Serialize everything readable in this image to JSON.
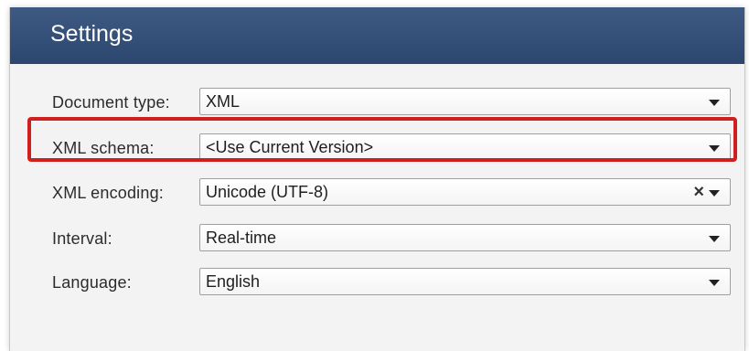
{
  "panel": {
    "title": "Settings"
  },
  "fields": {
    "document_type": {
      "label": "Document type:",
      "value": "XML"
    },
    "xml_schema": {
      "label": "XML schema:",
      "value": "<Use Current Version>"
    },
    "xml_encoding": {
      "label": "XML encoding:",
      "value": "Unicode (UTF-8)",
      "clear_symbol": "×"
    },
    "interval": {
      "label": "Interval:",
      "value": "Real-time"
    },
    "language": {
      "label": "Language:",
      "value": "English"
    }
  },
  "highlight": {
    "color": "#d01f1f",
    "target": "xml_schema"
  },
  "colors": {
    "header": "#2f4a73",
    "panel_bg": "#f3f3f3"
  },
  "icons": {
    "dropdown": "chevron-down-icon",
    "clear": "close-icon"
  }
}
